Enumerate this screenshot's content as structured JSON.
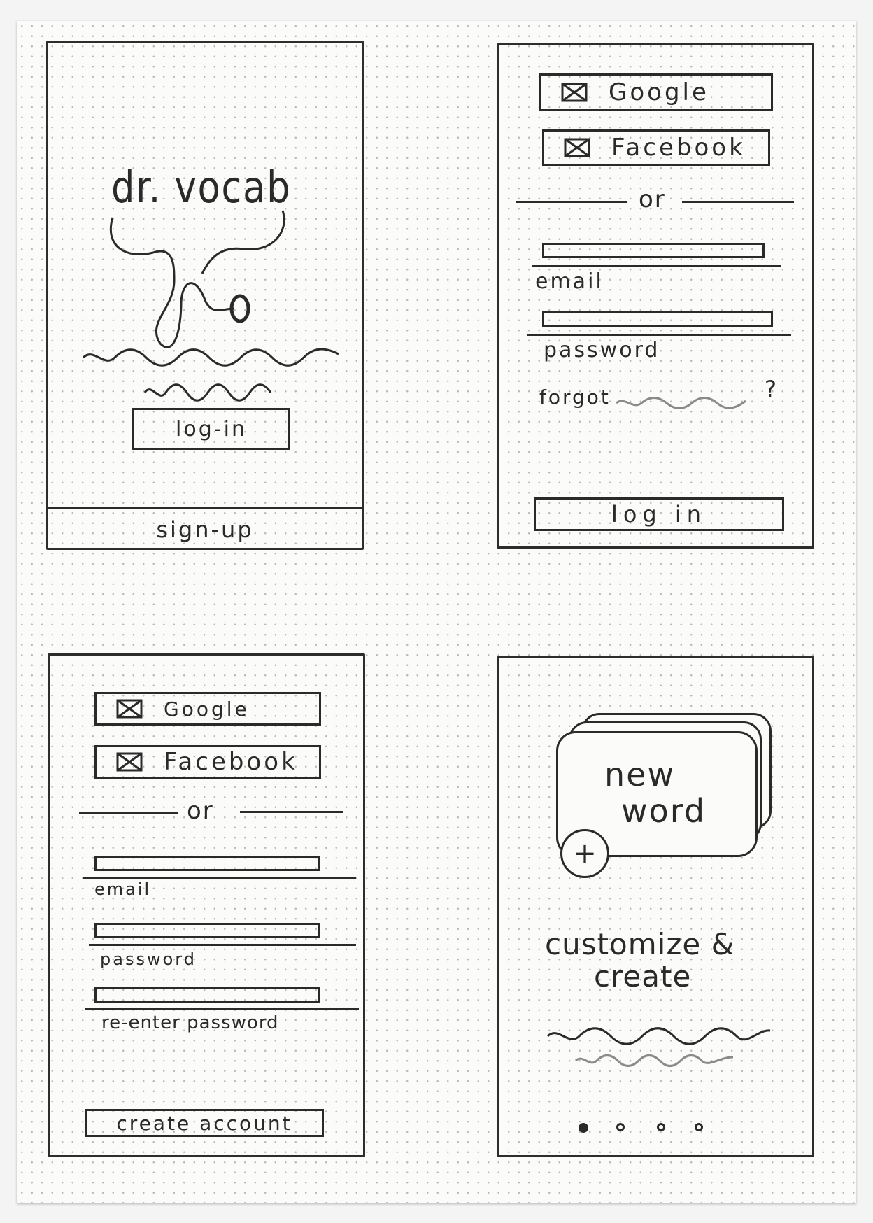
{
  "screen1": {
    "logo_text": "dr. vocab",
    "login_button": "log-in",
    "signup_label": "sign-up"
  },
  "screen2": {
    "google_label": "Google",
    "facebook_label": "Facebook",
    "or_label": "or",
    "email_label": "email",
    "password_label": "password",
    "forgot_label": "forgot",
    "forgot_mark": "?",
    "login_button": "log in"
  },
  "screen3": {
    "google_label": "Google",
    "facebook_label": "Facebook",
    "or_label": "or",
    "email_label": "email",
    "password_label": "password",
    "reenter_label": "re-enter password",
    "create_button": "create account"
  },
  "screen4": {
    "card_line1": "new",
    "card_line2": "word",
    "add_symbol": "+",
    "heading": "customize &",
    "heading_line2": "create",
    "page_dots": 4,
    "active_dot": 1
  },
  "colors": {
    "ink": "#2a2a2a",
    "paper": "#fbfbfa",
    "grid_dot": "#b9b9b9"
  }
}
